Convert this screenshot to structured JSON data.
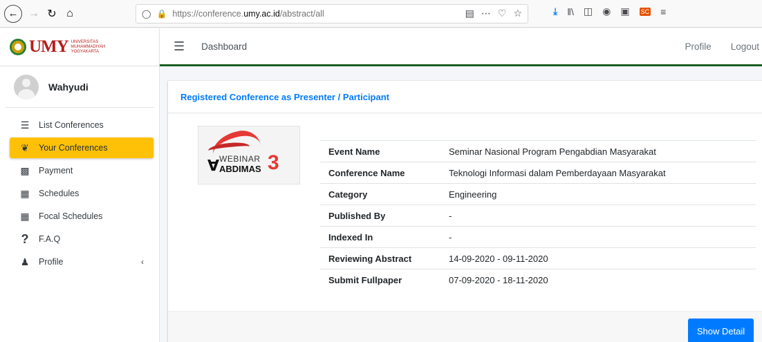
{
  "browser": {
    "url_prefix": "https://conference.",
    "url_domain": "umy.ac.id",
    "url_path": "/abstract/all",
    "sc_badge": "SC"
  },
  "sidebar": {
    "logo_text": "UMY",
    "logo_sub": [
      "UNIVERSITAS",
      "MUHAMMADIYAH",
      "YOGYAKARTA"
    ],
    "username": "Wahyudi",
    "items": [
      {
        "label": "List Conferences",
        "icon": "layers-icon",
        "active": false
      },
      {
        "label": "Your Conferences",
        "icon": "leaf-icon",
        "active": true
      },
      {
        "label": "Payment",
        "icon": "money-bill-icon",
        "active": false
      },
      {
        "label": "Schedules",
        "icon": "calendar-icon",
        "active": false
      },
      {
        "label": "Focal Schedules",
        "icon": "calendar-icon",
        "active": false
      },
      {
        "label": "F.A.Q",
        "icon": "question-icon",
        "active": false
      },
      {
        "label": "Profile",
        "icon": "user-icon",
        "active": false
      }
    ],
    "active_color": "#ffc107"
  },
  "topnav": {
    "dashboard": "Dashboard",
    "profile": "Profile",
    "logout": "Logout",
    "accent_color": "#1b5e20"
  },
  "card": {
    "title": "Registered Conference as Presenter / Participant",
    "poster": {
      "line1": "WEBINAR",
      "line2": "ABDIMAS",
      "number": "3"
    },
    "rows": [
      {
        "key": "Event Name",
        "value": "Seminar Nasional Program Pengabdian Masyarakat"
      },
      {
        "key": "Conference Name",
        "value": "Teknologi Informasi dalam Pemberdayaan Masyarakat"
      },
      {
        "key": "Category",
        "value": "Engineering"
      },
      {
        "key": "Published By",
        "value": "-"
      },
      {
        "key": "Indexed In",
        "value": "-"
      },
      {
        "key": "Reviewing Abstract",
        "value": "14-09-2020 - 09-11-2020"
      },
      {
        "key": "Submit Fullpaper",
        "value": "07-09-2020 - 18-11-2020"
      }
    ],
    "show_detail": "Show Detail",
    "title_color": "#007bff"
  }
}
